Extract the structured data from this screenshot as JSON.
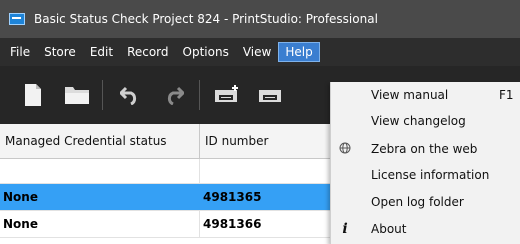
{
  "window": {
    "title": "Basic Status Check Project 824 - PrintStudio: Professional",
    "icon": "app-logo-icon"
  },
  "menubar": {
    "items": [
      {
        "label": "File",
        "active": false
      },
      {
        "label": "Store",
        "active": false
      },
      {
        "label": "Edit",
        "active": false
      },
      {
        "label": "Record",
        "active": false
      },
      {
        "label": "Options",
        "active": false
      },
      {
        "label": "View",
        "active": false
      },
      {
        "label": "Help",
        "active": true
      }
    ]
  },
  "toolbar": {
    "buttons": [
      "new-file-icon",
      "open-folder-icon",
      "undo-icon",
      "redo-icon",
      "printer-add-icon",
      "printer-icon"
    ]
  },
  "grid": {
    "columns": [
      "Managed Credential status",
      "ID number"
    ],
    "rows": [
      {
        "status": "None",
        "id": "4981365",
        "selected": true
      },
      {
        "status": "None",
        "id": "4981366",
        "selected": false
      }
    ]
  },
  "help_menu": {
    "items": [
      {
        "label": "View manual",
        "shortcut": "F1",
        "icon": ""
      },
      {
        "label": "View changelog",
        "shortcut": "",
        "icon": ""
      },
      {
        "label": "Zebra on the web",
        "shortcut": "",
        "icon": "globe-icon"
      },
      {
        "label": "License information",
        "shortcut": "",
        "icon": ""
      },
      {
        "label": "Open log folder",
        "shortcut": "",
        "icon": ""
      },
      {
        "label": "About",
        "shortcut": "",
        "icon": "info-icon"
      }
    ]
  },
  "colors": {
    "titlebar": "#4a4a4a",
    "menubar": "#2d2d2d",
    "toolbar": "#262626",
    "selection": "#35a0f5",
    "menu_highlight": "#3a7ed0"
  }
}
